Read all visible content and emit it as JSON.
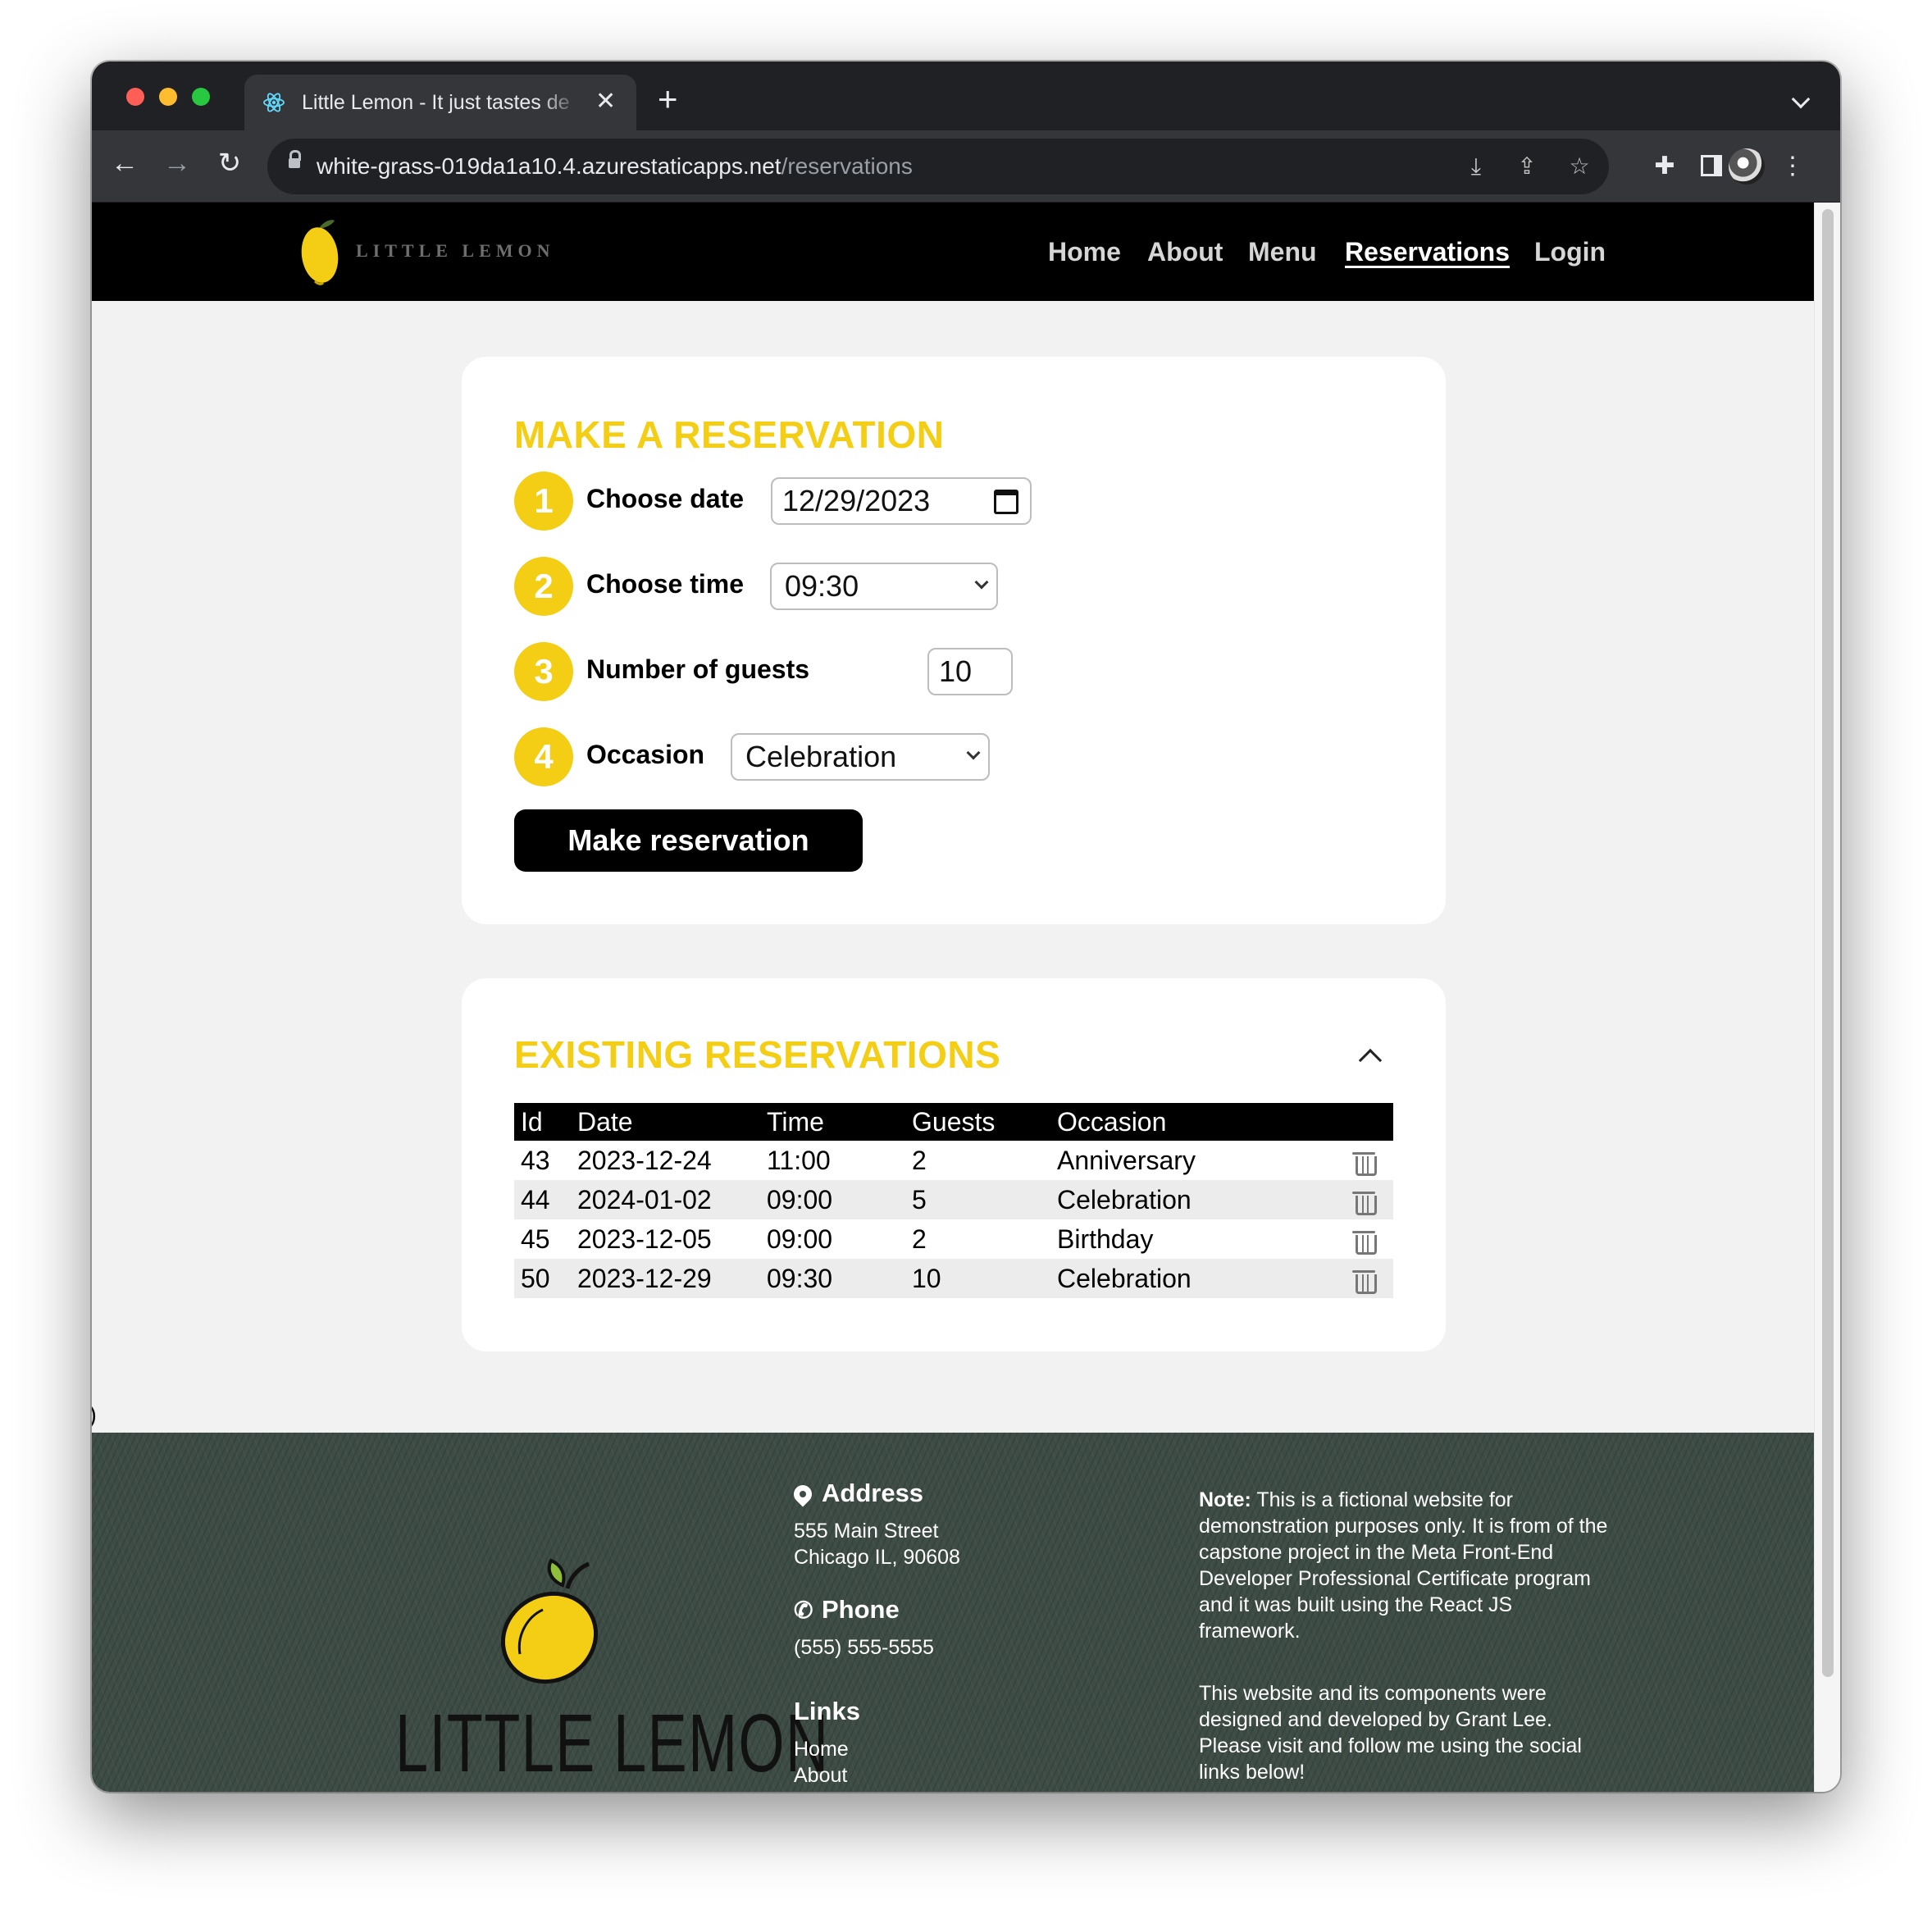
{
  "browser": {
    "tab_title": "Little Lemon - It just tastes de",
    "tab_close": "✕",
    "new_tab": "+",
    "url_host": "white-grass-019da1a10.4.azurestaticapps.net",
    "url_path": "/reservations"
  },
  "site": {
    "logo_text": "LITTLE LEMON",
    "nav": {
      "home": "Home",
      "about": "About",
      "menu": "Menu",
      "reservations": "Reservations",
      "login": "Login"
    },
    "active_nav": "Reservations"
  },
  "reservation_form": {
    "title": "MAKE A RESERVATION",
    "steps": [
      {
        "number": "1",
        "label": "Choose date",
        "value": "12/29/2023"
      },
      {
        "number": "2",
        "label": "Choose time",
        "value": "09:30"
      },
      {
        "number": "3",
        "label": "Number of guests",
        "value": "10"
      },
      {
        "number": "4",
        "label": "Occasion",
        "value": "Celebration"
      }
    ],
    "submit_label": "Make reservation"
  },
  "existing": {
    "title": "EXISTING RESERVATIONS",
    "columns": [
      "Id",
      "Date",
      "Time",
      "Guests",
      "Occasion"
    ],
    "rows": [
      {
        "id": "43",
        "date": "2023-12-24",
        "time": "11:00",
        "guests": "2",
        "occasion": "Anniversary"
      },
      {
        "id": "44",
        "date": "2024-01-02",
        "time": "09:00",
        "guests": "5",
        "occasion": "Celebration"
      },
      {
        "id": "45",
        "date": "2023-12-05",
        "time": "09:00",
        "guests": "2",
        "occasion": "Birthday"
      },
      {
        "id": "50",
        "date": "2023-12-29",
        "time": "09:30",
        "guests": "10",
        "occasion": "Celebration"
      }
    ]
  },
  "stray_char": ")",
  "footer": {
    "logo_text": "LITTLE LEMON",
    "address_heading": "Address",
    "address_line1": "555 Main Street",
    "address_line2": "Chicago IL, 90608",
    "phone_heading": "Phone",
    "phone_number": "(555) 555-5555",
    "links_heading": "Links",
    "links": [
      "Home",
      "About"
    ],
    "note_label": "Note:",
    "note_text": " This is a fictional website for demonstration purposes only. It is from of the capstone project in the Meta Front-End Developer Professional Certificate program and it was built using the React JS framework.",
    "credit_text": "This website and its components were designed and developed by Grant Lee. Please visit and follow me using the social links below!"
  },
  "colors": {
    "brand_yellow": "#f4ce14",
    "footer_green": "#3d4c44",
    "header_black": "#000000"
  }
}
